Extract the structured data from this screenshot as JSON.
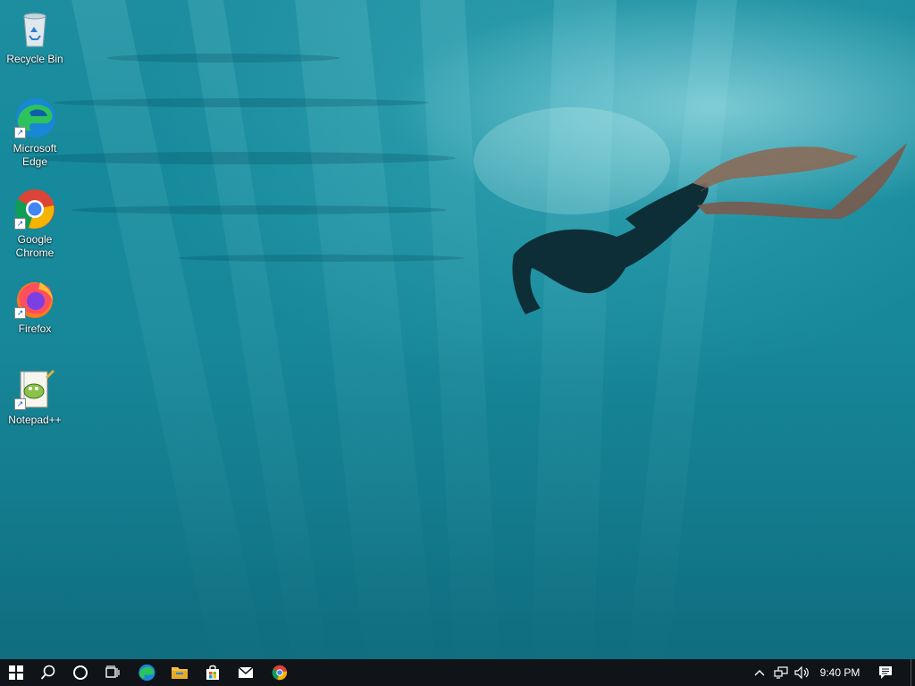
{
  "desktop": {
    "icons": [
      {
        "label": "Recycle Bin",
        "icon": "recycle-bin-icon"
      },
      {
        "label": "Microsoft Edge",
        "icon": "edge-icon"
      },
      {
        "label": "Google Chrome",
        "icon": "chrome-icon"
      },
      {
        "label": "Firefox",
        "icon": "firefox-icon"
      },
      {
        "label": "Notepad++",
        "icon": "notepad-plus-plus-icon"
      }
    ],
    "wallpaper": "underwater-freediver"
  },
  "taskbar": {
    "pinned": [
      "start-icon",
      "search-icon",
      "cortana-icon",
      "task-view-icon",
      "edge-icon",
      "file-explorer-icon",
      "microsoft-store-icon",
      "mail-icon",
      "chrome-icon"
    ],
    "tray": {
      "time": "9:40 PM",
      "icons": [
        "chevron-up-icon",
        "network-icon",
        "volume-icon",
        "action-center-icon"
      ]
    }
  },
  "colors": {
    "taskbar": "#101418",
    "water": "#178a9c",
    "windows_blue": "#ffffff"
  }
}
